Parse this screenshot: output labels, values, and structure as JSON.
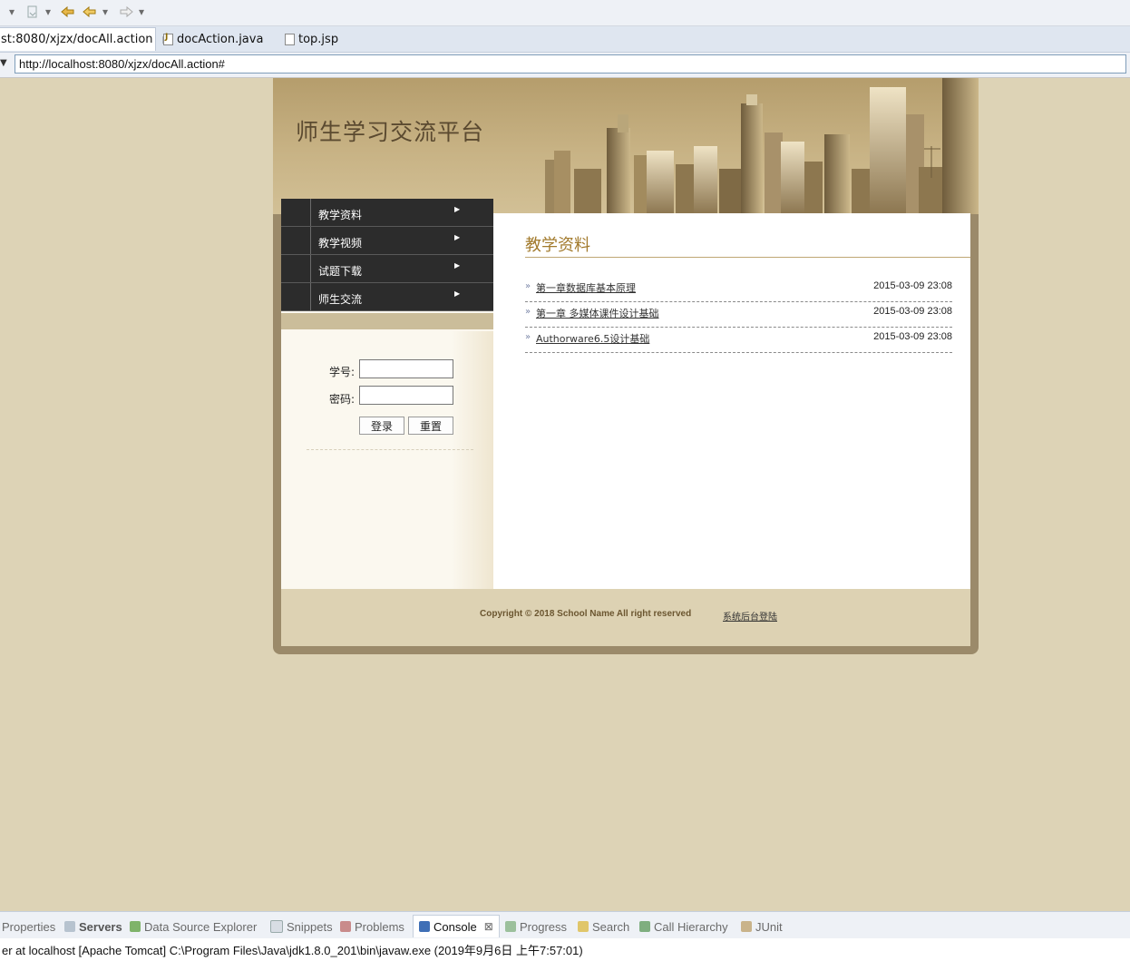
{
  "toolbar": {
    "icons": [
      "dropdown-arrow",
      "next-annotation-icon",
      "last-edit-location-icon",
      "back-icon",
      "forward-icon"
    ]
  },
  "editor_tabs": [
    {
      "label": "st:8080/xjzx/docAll.action",
      "active": true,
      "close": "⊠"
    },
    {
      "label": "docAction.java",
      "active": false
    },
    {
      "label": "top.jsp",
      "active": false
    }
  ],
  "browser": {
    "url": "http://localhost:8080/xjzx/docAll.action#"
  },
  "page": {
    "site_title": "师生学习交流平台",
    "menu": [
      {
        "label": "教学资料"
      },
      {
        "label": "教学视频"
      },
      {
        "label": "试题下载"
      },
      {
        "label": "师生交流"
      }
    ],
    "login": {
      "student_id_label": "学号:",
      "password_label": "密码:",
      "login_button": "登录",
      "reset_button": "重置"
    },
    "main": {
      "section_title": "教学资料",
      "documents": [
        {
          "title": "第一章数据库基本原理",
          "date": "2015-03-09 23:08"
        },
        {
          "title": "第一章 多媒体课件设计基础",
          "date": "2015-03-09 23:08"
        },
        {
          "title": "Authorware6.5设计基础",
          "date": "2015-03-09 23:08"
        }
      ]
    },
    "footer": {
      "copyright": "Copyright © 2018 School Name All right reserved",
      "admin_link": "系统后台登陆"
    }
  },
  "views": {
    "tabs": [
      {
        "label": "Properties"
      },
      {
        "label": "Servers"
      },
      {
        "label": "Data Source Explorer"
      },
      {
        "label": "Snippets"
      },
      {
        "label": "Problems"
      },
      {
        "label": "Console",
        "close": "⊠"
      },
      {
        "label": "Progress"
      },
      {
        "label": "Search"
      },
      {
        "label": "Call Hierarchy"
      },
      {
        "label": "JUnit"
      }
    ],
    "console_text": "er at localhost [Apache Tomcat] C:\\Program Files\\Java\\jdk1.8.0_201\\bin\\javaw.exe (2019年9月6日 上午7:57:01)"
  },
  "colors": {
    "page_bg": "#ddd3b6",
    "menu_bg": "#2c2c2c",
    "section_title": "#a27a2c",
    "frame": "#9b8a6a"
  }
}
